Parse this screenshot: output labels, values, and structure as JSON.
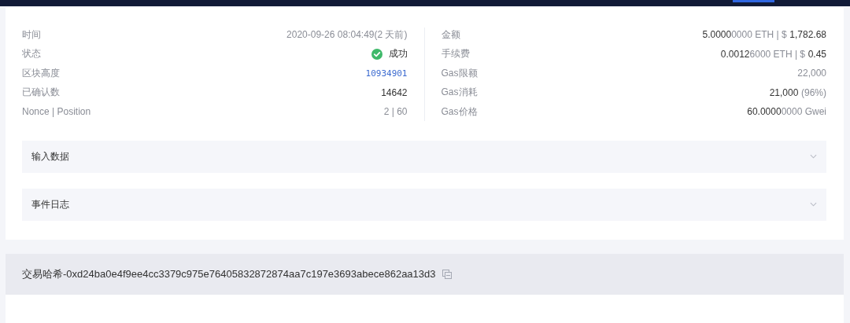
{
  "details_left": [
    {
      "label": "时间",
      "kind": "text",
      "value": [
        {
          "text": "2020-09-26 08:04:49(2 天前)",
          "muted": true,
          "spaced": false
        }
      ]
    },
    {
      "label": "状态",
      "kind": "status",
      "success": true,
      "value": [
        {
          "text": "成功",
          "muted": false,
          "spaced": false
        }
      ]
    },
    {
      "label": "区块高度",
      "kind": "link",
      "value": [
        {
          "text": "10934901",
          "muted": false,
          "spaced": false
        }
      ]
    },
    {
      "label": "已确认数",
      "kind": "text",
      "value": [
        {
          "text": "14642",
          "muted": false,
          "spaced": false
        }
      ]
    },
    {
      "label": "Nonce | Position",
      "kind": "text",
      "value": [
        {
          "text": "2 | 60",
          "muted": true,
          "spaced": false
        }
      ]
    }
  ],
  "details_right": [
    {
      "label": "金额",
      "kind": "text",
      "value": [
        {
          "text": "5.0000",
          "muted": false,
          "spaced": false
        },
        {
          "text": "0000 ETH | $",
          "muted": true,
          "spaced": false
        },
        {
          "text": "1,782.68",
          "muted": false,
          "spaced": true
        }
      ]
    },
    {
      "label": "手续费",
      "kind": "text",
      "value": [
        {
          "text": "0.0012",
          "muted": false,
          "spaced": false
        },
        {
          "text": "6000 ETH | $",
          "muted": true,
          "spaced": false
        },
        {
          "text": "0.45",
          "muted": false,
          "spaced": true
        }
      ]
    },
    {
      "label": "Gas限额",
      "kind": "text",
      "value": [
        {
          "text": "22,000",
          "muted": true,
          "spaced": false
        }
      ]
    },
    {
      "label": "Gas消耗",
      "kind": "text",
      "value": [
        {
          "text": "21,000",
          "muted": false,
          "spaced": false
        },
        {
          "text": "(96%)",
          "muted": true,
          "spaced": true
        }
      ]
    },
    {
      "label": "Gas价格",
      "kind": "text",
      "value": [
        {
          "text": "60.0000",
          "muted": false,
          "spaced": false
        },
        {
          "text": "0000 Gwei",
          "muted": true,
          "spaced": false
        }
      ]
    }
  ],
  "sections": [
    {
      "title": "输入数据",
      "expanded": false
    },
    {
      "title": "事件日志",
      "expanded": false
    }
  ],
  "next_card": {
    "title": "交易哈希-0xd24ba0e4f9ee4cc3379c975e76405832872874aa7c197e3693abece862aa13d3"
  }
}
